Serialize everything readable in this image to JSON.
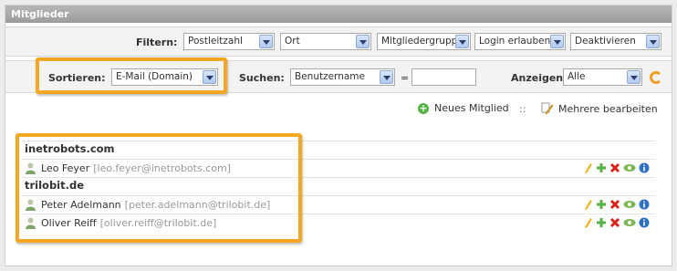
{
  "header": {
    "title": "Mitglieder"
  },
  "filters": {
    "label": "Filtern:",
    "selects": [
      "Postleitzahl",
      "Ort",
      "Mitgliedergruppen",
      "Login erlauben",
      "Deaktivieren"
    ]
  },
  "sorting": {
    "label": "Sortieren:",
    "value": "E-Mail (Domain)"
  },
  "search": {
    "label": "Suchen:",
    "field": "Benutzername",
    "operator": "=",
    "value": ""
  },
  "display": {
    "label": "Anzeigen:",
    "value": "Alle"
  },
  "actions": {
    "new_member": "Neues Mitglied",
    "separator": "::",
    "edit_multiple": "Mehrere bearbeiten"
  },
  "groups": [
    {
      "domain": "inetrobots.com",
      "members": [
        {
          "name": "Leo Feyer",
          "email": "[leo.feyer@inetrobots.com]"
        }
      ]
    },
    {
      "domain": "trilobit.de",
      "members": [
        {
          "name": "Peter Adelmann",
          "email": "[peter.adelmann@trilobit.de]"
        },
        {
          "name": "Oliver Reiff",
          "email": "[oliver.reiff@trilobit.de]"
        }
      ]
    }
  ],
  "colors": {
    "highlight": "#f5a623",
    "header_bg": "#a9a9a9",
    "add_green": "#58b147",
    "delete_red": "#d9241c",
    "info_blue": "#2d6fc4"
  },
  "icons": {
    "row_icons": [
      "edit-pencil-icon",
      "copy-plus-icon",
      "delete-x-icon",
      "view-eye-icon",
      "info-icon"
    ]
  }
}
